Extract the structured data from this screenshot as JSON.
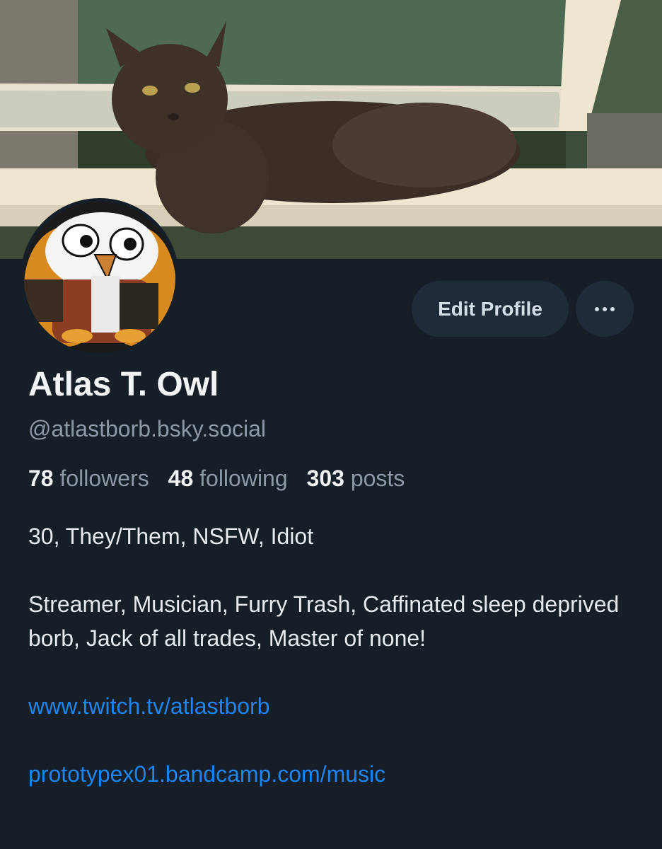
{
  "profile": {
    "display_name": "Atlas T. Owl",
    "handle": "@atlastborb.bsky.social",
    "stats": {
      "followers_count": "78",
      "followers_label": "followers",
      "following_count": "48",
      "following_label": "following",
      "posts_count": "303",
      "posts_label": "posts"
    },
    "bio": {
      "line1": "30, They/Them, NSFW, Idiot",
      "line2": "Streamer, Musician, Furry Trash, Caffinated sleep deprived borb, Jack of all trades, Master of none!",
      "link1": "www.twitch.tv/atlastborb",
      "link2": "prototypex01.bandcamp.com/music"
    }
  },
  "actions": {
    "edit_profile_label": "Edit Profile",
    "more_icon": "ellipsis-icon"
  },
  "colors": {
    "background": "#161e27",
    "button_bg": "#1f2b38",
    "link": "#1d85f2",
    "muted_text": "#8d99a6"
  }
}
